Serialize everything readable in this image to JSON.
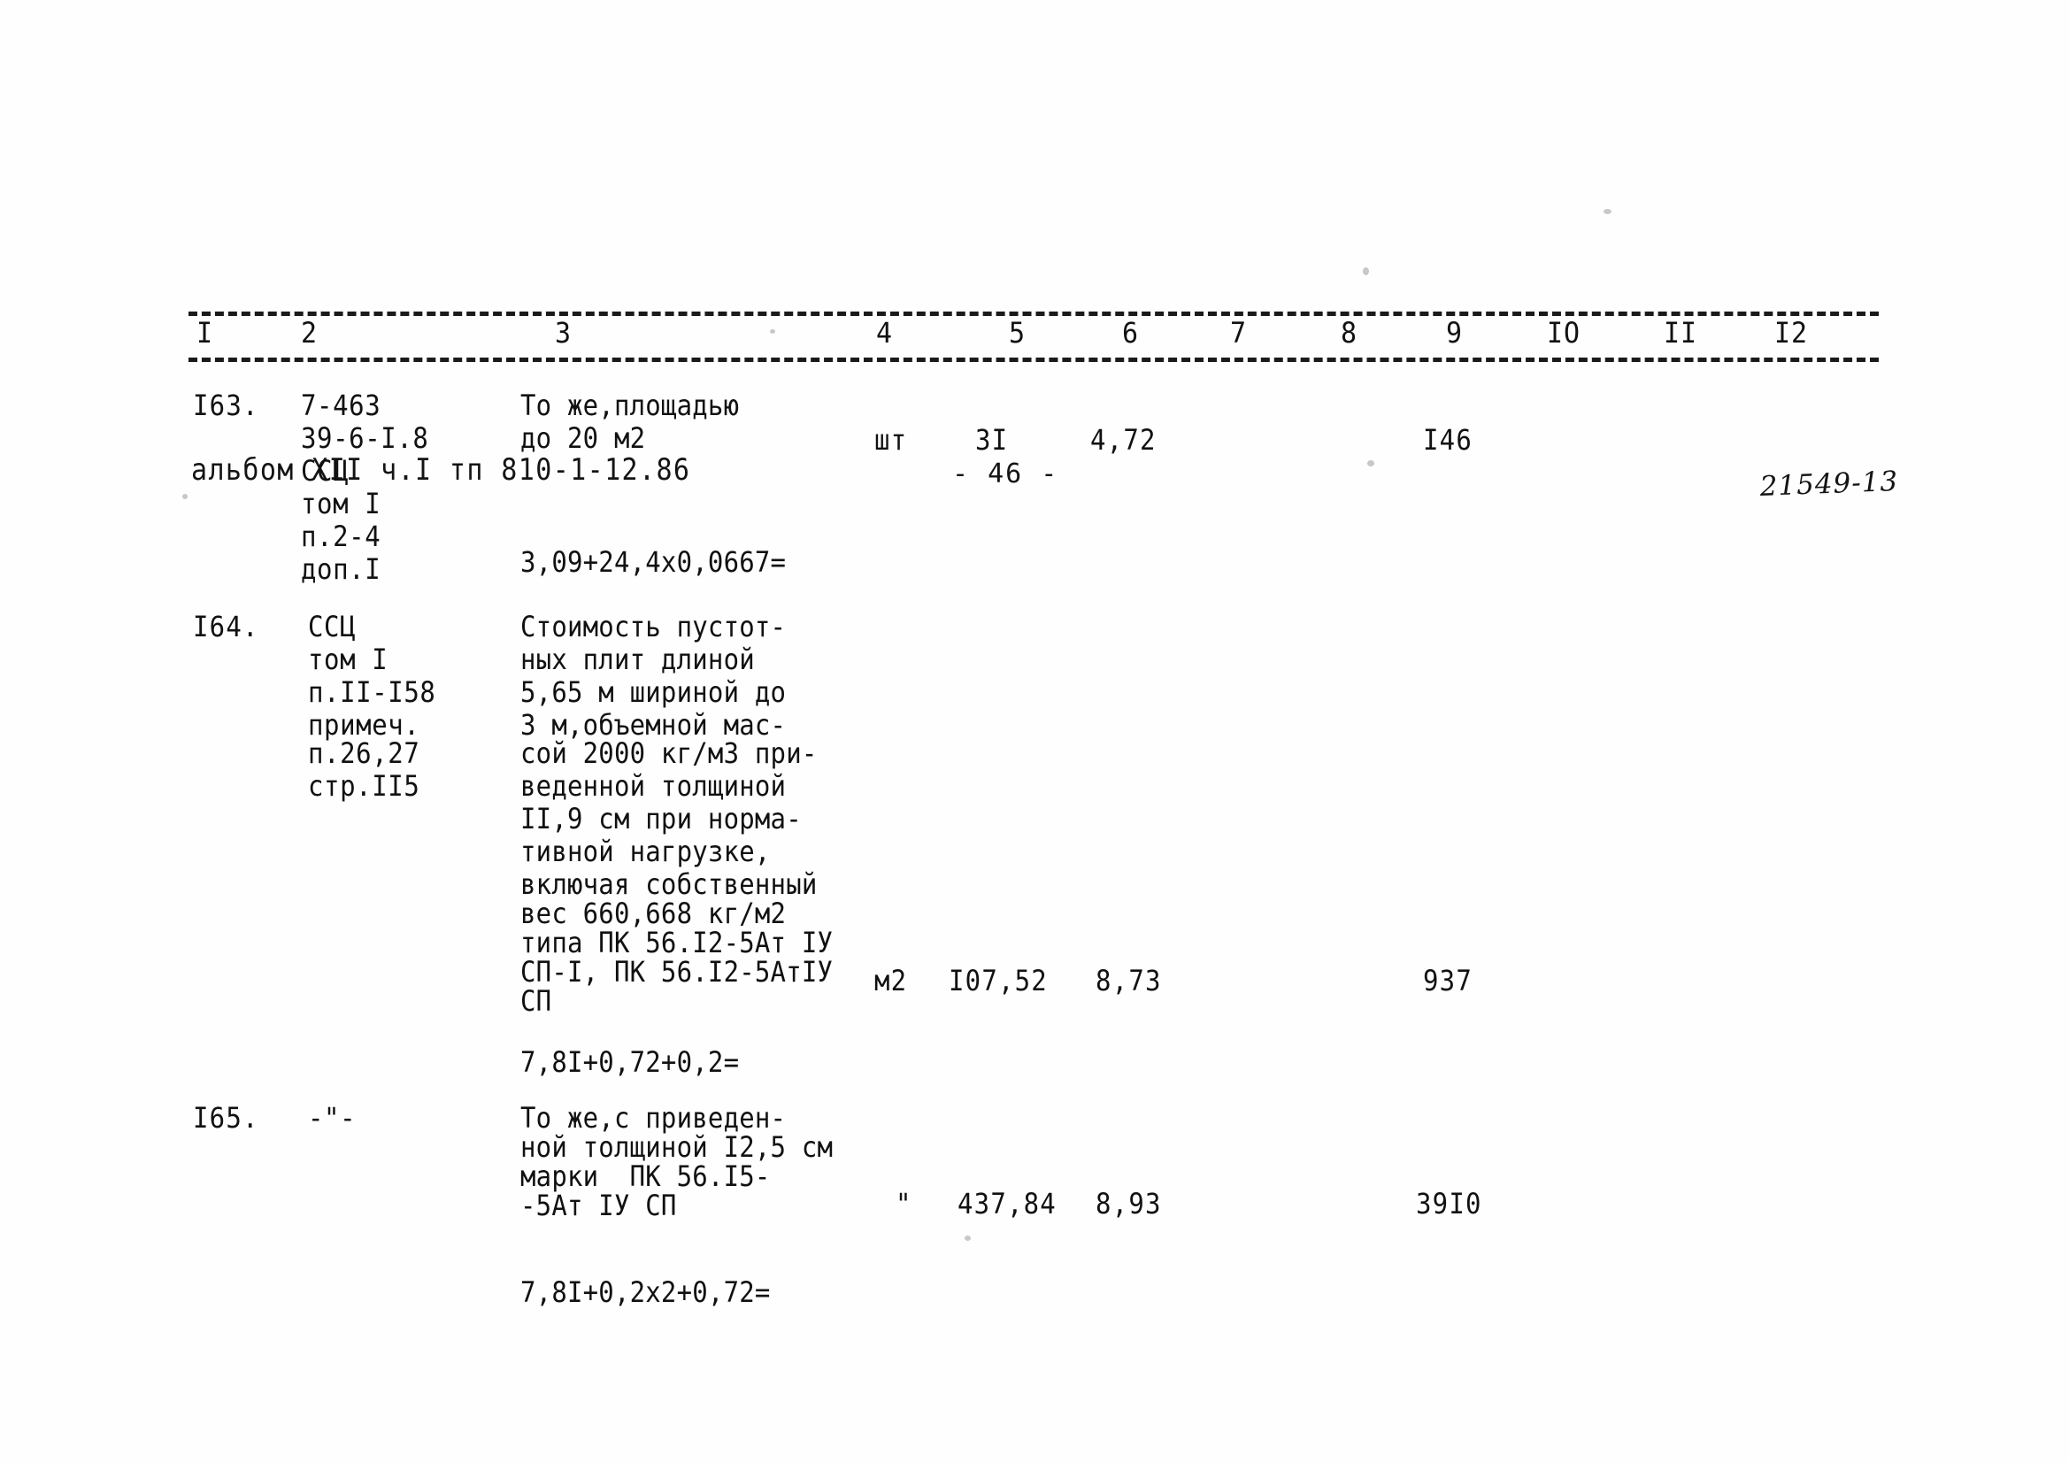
{
  "header": {
    "album": "альбом XII ч.I тп 810-1-12.86",
    "page_number": "- 46 -",
    "stamp_code": "21549-13"
  },
  "table": {
    "column_headers": [
      "I",
      "2",
      "3",
      "4",
      "5",
      "6",
      "7",
      "8",
      "9",
      "IO",
      "II",
      "I2"
    ],
    "rows": [
      {
        "id": "row-163",
        "col1": "I63.",
        "col2": [
          "7-463",
          "39-6-I.8",
          "ССЦ",
          "том I",
          "п.2-4",
          "доп.I"
        ],
        "col3": [
          "То же,площадью",
          "до 20 м2"
        ],
        "col3_formula": "3,09+24,4х0,0667=",
        "col4": "шт",
        "col5": "3I",
        "col6": "4,72",
        "col9": "I46"
      },
      {
        "id": "row-164",
        "col1": "I64.",
        "col2": [
          "ССЦ",
          "том I",
          "п.II-I58",
          "примеч.",
          "п.26,27",
          "стр.II5"
        ],
        "col3": [
          "Стоимость пустот-",
          "ных плит длиной",
          "5,65 м шириной до",
          "3 м,объемной мас-",
          "сой 2000 кг/м3 при-",
          "веденной толщиной",
          "II,9 см при норма-",
          "тивной нагрузке,",
          "включая собственный",
          "вес 660,668 кг/м2",
          "типа ПК 56.I2-5Ат IУ",
          "СП-I, ПК 56.I2-5АтIУ",
          "СП"
        ],
        "col3_formula": "7,8I+0,72+0,2=",
        "col4": "м2",
        "col5": "I07,52",
        "col6": "8,73",
        "col9": "937"
      },
      {
        "id": "row-165",
        "col1": "I65.",
        "col2": [
          "-\"-"
        ],
        "col3": [
          "То же,с приведен-",
          "ной толщиной I2,5 см",
          "марки  ПК 56.I5-",
          "-5Ат IУ СП"
        ],
        "col3_formula": "7,8I+0,2x2+0,72=",
        "col4": "\"",
        "col5": "437,84",
        "col6": "8,93",
        "col9": "39I0"
      }
    ]
  },
  "colors": {
    "ink": "#141414",
    "paper": "#fefefe"
  }
}
